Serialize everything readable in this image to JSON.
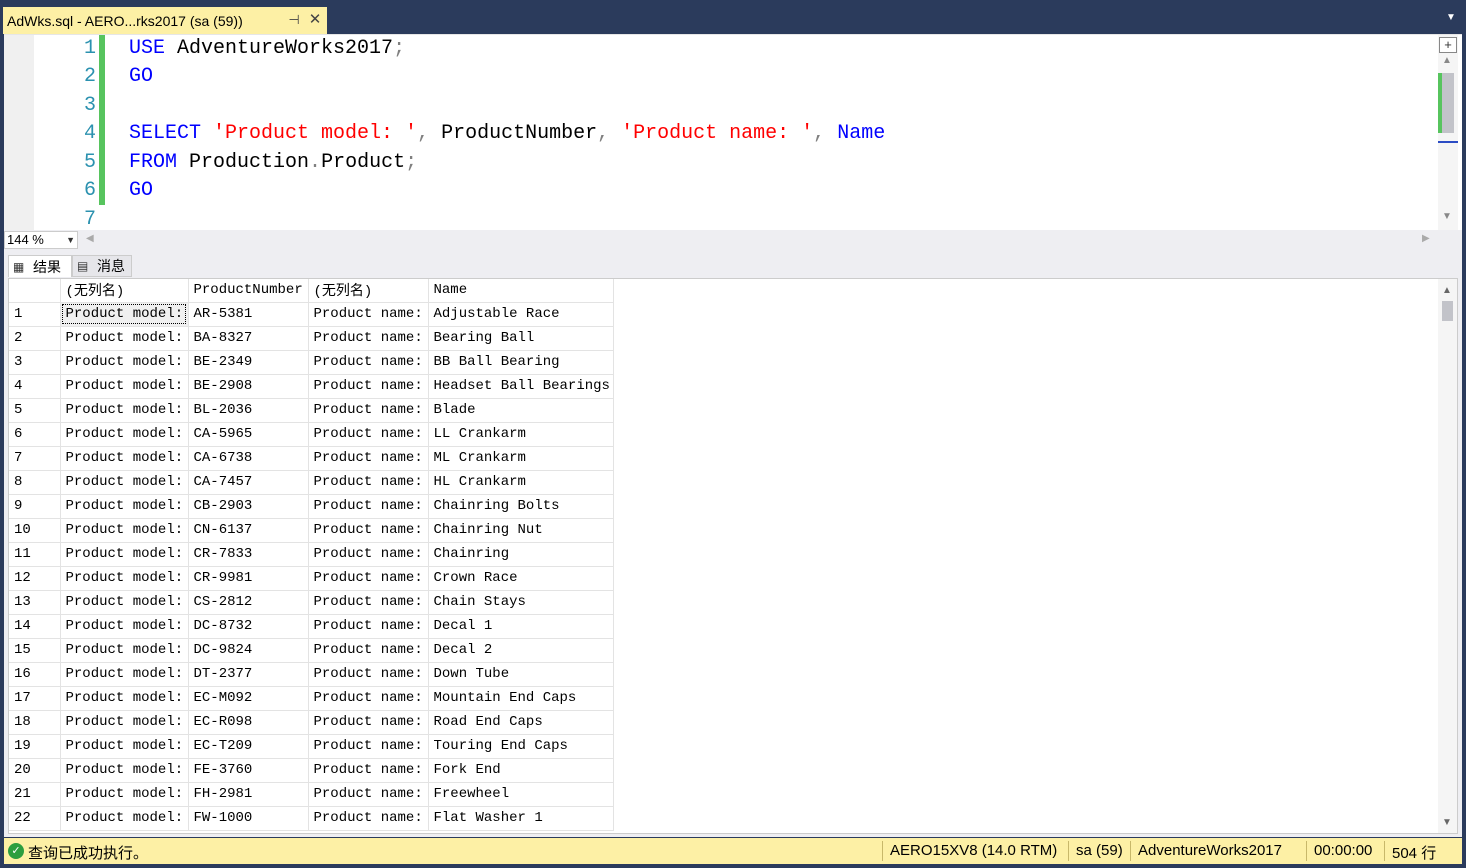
{
  "tab": {
    "title": "AdWks.sql - AERO...rks2017 (sa (59))",
    "pin_glyph": "⊣",
    "close_glyph": "✕"
  },
  "editor": {
    "line_numbers": [
      "1",
      "2",
      "3",
      "4",
      "5",
      "6",
      "7"
    ],
    "zoom": "144 %"
  },
  "code": {
    "l1_kw": "USE",
    "l1_db": " AdventureWorks2017",
    "l1_semi": ";",
    "l2_kw": "GO",
    "l4_kw": "SELECT",
    "l4_str1": " 'Product model: '",
    "l4_c1": ",",
    "l4_col1": " ProductNumber",
    "l4_c2": ",",
    "l4_str2": " 'Product name: '",
    "l4_c3": ",",
    "l4_name": " Name",
    "l5_kw": "FROM",
    "l5_schema": " Production",
    "l5_dot": ".",
    "l5_table": "Product",
    "l5_semi": ";",
    "l6_kw": "GO"
  },
  "results": {
    "tab_results": "结果",
    "tab_messages": "消息",
    "headers": [
      "",
      "(无列名)",
      "ProductNumber",
      "(无列名)",
      "Name"
    ],
    "rows": [
      [
        "1",
        "Product model:",
        "AR-5381",
        "Product name:",
        "Adjustable Race"
      ],
      [
        "2",
        "Product model:",
        "BA-8327",
        "Product name:",
        "Bearing Ball"
      ],
      [
        "3",
        "Product model:",
        "BE-2349",
        "Product name:",
        "BB Ball Bearing"
      ],
      [
        "4",
        "Product model:",
        "BE-2908",
        "Product name:",
        "Headset Ball Bearings"
      ],
      [
        "5",
        "Product model:",
        "BL-2036",
        "Product name:",
        "Blade"
      ],
      [
        "6",
        "Product model:",
        "CA-5965",
        "Product name:",
        "LL Crankarm"
      ],
      [
        "7",
        "Product model:",
        "CA-6738",
        "Product name:",
        "ML Crankarm"
      ],
      [
        "8",
        "Product model:",
        "CA-7457",
        "Product name:",
        "HL Crankarm"
      ],
      [
        "9",
        "Product model:",
        "CB-2903",
        "Product name:",
        "Chainring Bolts"
      ],
      [
        "10",
        "Product model:",
        "CN-6137",
        "Product name:",
        "Chainring Nut"
      ],
      [
        "11",
        "Product model:",
        "CR-7833",
        "Product name:",
        "Chainring"
      ],
      [
        "12",
        "Product model:",
        "CR-9981",
        "Product name:",
        "Crown Race"
      ],
      [
        "13",
        "Product model:",
        "CS-2812",
        "Product name:",
        "Chain Stays"
      ],
      [
        "14",
        "Product model:",
        "DC-8732",
        "Product name:",
        "Decal 1"
      ],
      [
        "15",
        "Product model:",
        "DC-9824",
        "Product name:",
        "Decal 2"
      ],
      [
        "16",
        "Product model:",
        "DT-2377",
        "Product name:",
        "Down Tube"
      ],
      [
        "17",
        "Product model:",
        "EC-M092",
        "Product name:",
        "Mountain End Caps"
      ],
      [
        "18",
        "Product model:",
        "EC-R098",
        "Product name:",
        "Road End Caps"
      ],
      [
        "19",
        "Product model:",
        "EC-T209",
        "Product name:",
        "Touring End Caps"
      ],
      [
        "20",
        "Product model:",
        "FE-3760",
        "Product name:",
        "Fork End"
      ],
      [
        "21",
        "Product model:",
        "FH-2981",
        "Product name:",
        "Freewheel"
      ],
      [
        "22",
        "Product model:",
        "FW-1000",
        "Product name:",
        "Flat Washer 1"
      ]
    ]
  },
  "status": {
    "message": "查询已成功执行。",
    "server": "AERO15XV8 (14.0 RTM)",
    "user": "sa (59)",
    "database": "AdventureWorks2017",
    "elapsed": "00:00:00",
    "row_count": "504 行"
  }
}
